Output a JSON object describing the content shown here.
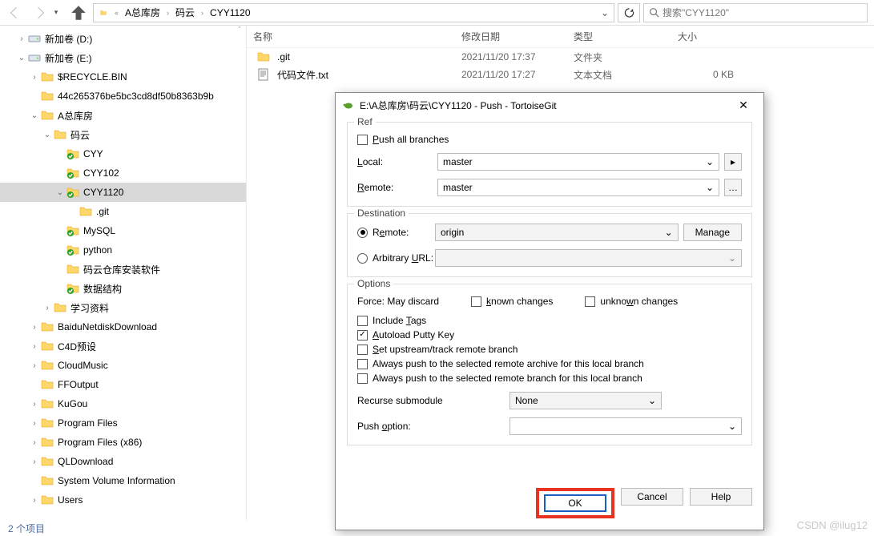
{
  "nav": {
    "crumb_root_icon": "folder-yellow",
    "crumb": [
      "A总库房",
      "码云",
      "CYY1120"
    ],
    "search_placeholder": "搜索\"CYY1120\""
  },
  "tree": [
    {
      "depth": 0,
      "icon": "drive",
      "label": "新加卷 (D:)",
      "tw": ">"
    },
    {
      "depth": 0,
      "icon": "drive",
      "label": "新加卷 (E:)",
      "tw": "v"
    },
    {
      "depth": 1,
      "icon": "folder",
      "label": "$RECYCLE.BIN",
      "tw": ">"
    },
    {
      "depth": 1,
      "icon": "folder",
      "label": "44c265376be5bc3cd8df50b8363b9b",
      "tw": ""
    },
    {
      "depth": 1,
      "icon": "folder",
      "label": "A总库房",
      "tw": "v"
    },
    {
      "depth": 2,
      "icon": "folder",
      "label": "码云",
      "tw": "v"
    },
    {
      "depth": 3,
      "icon": "folder-git",
      "label": "CYY",
      "tw": ""
    },
    {
      "depth": 3,
      "icon": "folder-git",
      "label": "CYY102",
      "tw": ""
    },
    {
      "depth": 3,
      "icon": "folder-git",
      "label": "CYY1120",
      "tw": "v",
      "sel": true
    },
    {
      "depth": 4,
      "icon": "folder",
      "label": ".git",
      "tw": ""
    },
    {
      "depth": 3,
      "icon": "folder-git",
      "label": "MySQL",
      "tw": ""
    },
    {
      "depth": 3,
      "icon": "folder-git",
      "label": "python",
      "tw": ""
    },
    {
      "depth": 3,
      "icon": "folder",
      "label": "码云仓库安装软件",
      "tw": ""
    },
    {
      "depth": 3,
      "icon": "folder-git",
      "label": "数据结构",
      "tw": ""
    },
    {
      "depth": 2,
      "icon": "folder",
      "label": "学习资料",
      "tw": ">"
    },
    {
      "depth": 1,
      "icon": "folder",
      "label": "BaiduNetdiskDownload",
      "tw": ">"
    },
    {
      "depth": 1,
      "icon": "folder",
      "label": "C4D预设",
      "tw": ">"
    },
    {
      "depth": 1,
      "icon": "folder",
      "label": "CloudMusic",
      "tw": ">"
    },
    {
      "depth": 1,
      "icon": "folder",
      "label": "FFOutput",
      "tw": ""
    },
    {
      "depth": 1,
      "icon": "folder",
      "label": "KuGou",
      "tw": ">"
    },
    {
      "depth": 1,
      "icon": "folder",
      "label": "Program Files",
      "tw": ">"
    },
    {
      "depth": 1,
      "icon": "folder",
      "label": "Program Files (x86)",
      "tw": ">"
    },
    {
      "depth": 1,
      "icon": "folder",
      "label": "QLDownload",
      "tw": ">"
    },
    {
      "depth": 1,
      "icon": "folder",
      "label": "System Volume Information",
      "tw": ""
    },
    {
      "depth": 1,
      "icon": "folder",
      "label": "Users",
      "tw": ">"
    }
  ],
  "columns": {
    "name": "名称",
    "date": "修改日期",
    "type": "类型",
    "size": "大小"
  },
  "files": [
    {
      "name": ".git",
      "date": "2021/11/20 17:37",
      "type": "文件夹",
      "size": ""
    },
    {
      "name": "代码文件.txt",
      "date": "2021/11/20 17:27",
      "type": "文本文档",
      "size": "0 KB"
    }
  ],
  "status": "2 个项目",
  "dialog": {
    "title": "E:\\A总库房\\码云\\CYY1120 - Push - TortoiseGit",
    "ref": {
      "legend": "Ref",
      "push_all": "Push all branches",
      "local_label": "Local:",
      "local_value": "master",
      "remote_label": "Remote:",
      "remote_value": "master"
    },
    "dest": {
      "legend": "Destination",
      "remote_label": "Remote:",
      "remote_value": "origin",
      "manage": "Manage",
      "arb_label": "Arbitrary URL:"
    },
    "opts": {
      "legend": "Options",
      "force": "Force: May discard",
      "known": "known changes",
      "unknown": "unknown changes",
      "include_tags": "Include Tags",
      "autoload": "Autoload Putty Key",
      "upstream": "Set upstream/track remote branch",
      "always_archive": "Always push to the selected remote archive for this local branch",
      "always_branch": "Always push to the selected remote branch for this local branch",
      "recurse_label": "Recurse submodule",
      "recurse_value": "None",
      "pushopt_label": "Push option:"
    },
    "buttons": {
      "ok": "OK",
      "cancel": "Cancel",
      "help": "Help"
    }
  },
  "watermark": "CSDN @ilug12"
}
